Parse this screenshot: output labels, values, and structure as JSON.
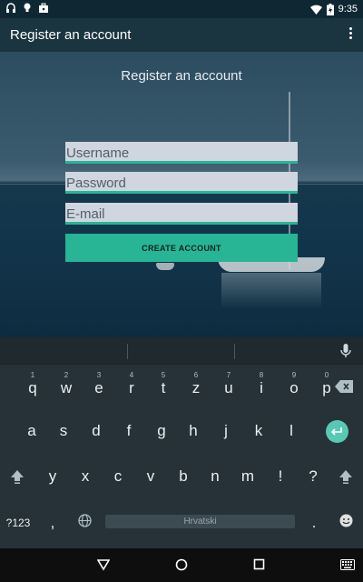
{
  "status_bar": {
    "time": "9:35",
    "icons_left": [
      "headset-icon",
      "bulb-icon",
      "briefcase-icon"
    ],
    "icons_right": [
      "wifi-icon",
      "battery-charging-icon"
    ]
  },
  "app_bar": {
    "title": "Register an account",
    "menu_icon": "overflow-menu-icon"
  },
  "form": {
    "title": "Register an account",
    "username_placeholder": "Username",
    "password_placeholder": "Password",
    "email_placeholder": "E-mail",
    "submit_label": "CREATE ACCOUNT"
  },
  "keyboard": {
    "row1": [
      {
        "key": "q",
        "hint": "1"
      },
      {
        "key": "w",
        "hint": "2"
      },
      {
        "key": "e",
        "hint": "3"
      },
      {
        "key": "r",
        "hint": "4"
      },
      {
        "key": "t",
        "hint": "5"
      },
      {
        "key": "z",
        "hint": "6"
      },
      {
        "key": "u",
        "hint": "7"
      },
      {
        "key": "i",
        "hint": "8"
      },
      {
        "key": "o",
        "hint": "9"
      },
      {
        "key": "p",
        "hint": "0"
      }
    ],
    "row2": [
      "a",
      "s",
      "d",
      "f",
      "g",
      "h",
      "j",
      "k",
      "l"
    ],
    "row3": [
      "y",
      "x",
      "c",
      "v",
      "b",
      "n",
      "m",
      "!",
      "?"
    ],
    "row4": {
      "symbols": "?123",
      "comma": ",",
      "space_label": "Hrvatski",
      "period": "."
    },
    "accent_color": "#5ac8b4"
  },
  "colors": {
    "accent": "#27b595",
    "app_bar": "#1b3540",
    "keyboard_bg": "#263238"
  }
}
